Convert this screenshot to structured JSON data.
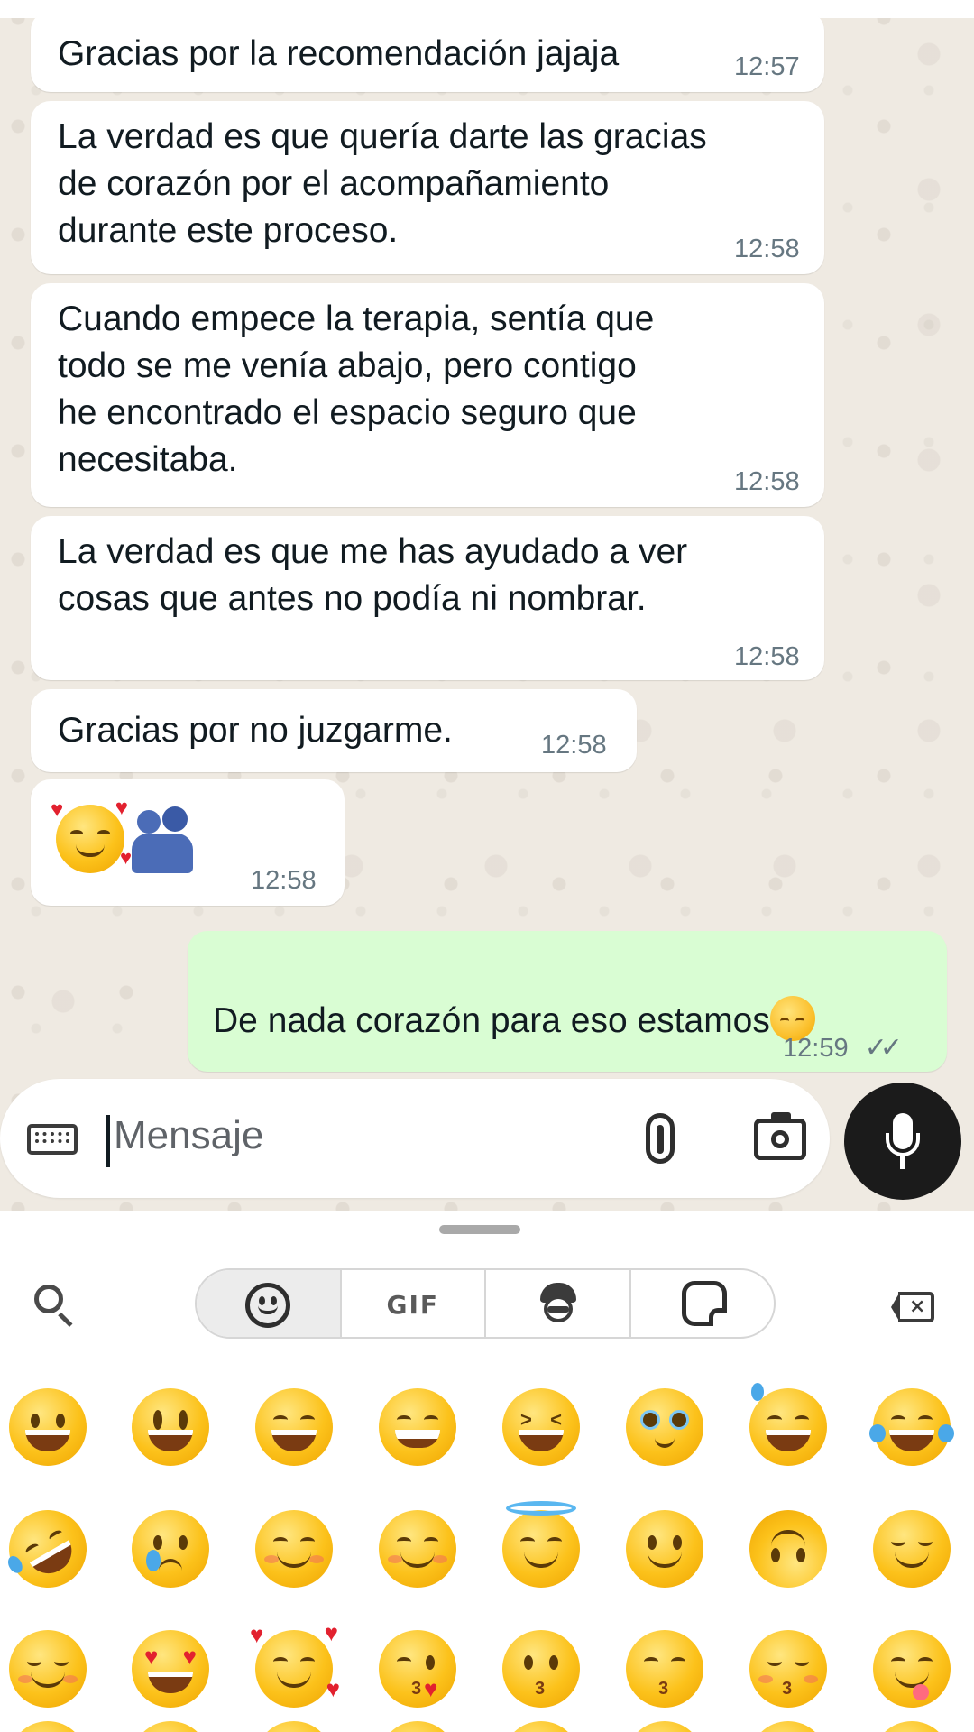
{
  "messages": [
    {
      "direction": "in",
      "text": "Gracias por la recomendación jajaja",
      "time": "12:57"
    },
    {
      "direction": "in",
      "text": "La verdad es que quería darte las gracias\nde corazón por el acompañamiento\ndurante este proceso.",
      "time": "12:58"
    },
    {
      "direction": "in",
      "text": "Cuando empece la terapia, sentía que\ntodo se me venía abajo, pero contigo\nhe encontrado el espacio seguro que\nnecesitaba.",
      "time": "12:58"
    },
    {
      "direction": "in",
      "text": "La verdad es que me has ayudado a ver\ncosas que antes no podía ni nombrar.",
      "time": "12:58"
    },
    {
      "direction": "in",
      "text": "Gracias por no juzgarme.",
      "time": "12:58"
    },
    {
      "direction": "in",
      "emojis": [
        "smiling-face-with-hearts",
        "people-hugging"
      ],
      "time": "12:58"
    },
    {
      "direction": "out",
      "text": "De nada corazón para eso estamos",
      "trailing_emoji": "smiling-face-with-smiling-eyes",
      "time": "12:59",
      "status": "read"
    }
  ],
  "composer": {
    "placeholder": "Mensaje",
    "keyboard_icon": "keyboard-icon",
    "attach_icon": "paperclip-icon",
    "camera_icon": "camera-icon",
    "mic_icon": "microphone-icon"
  },
  "emoji_keyboard": {
    "search_icon": "search-icon",
    "tabs": [
      {
        "icon": "emoji-tab-icon",
        "active": true
      },
      {
        "label": "GIF"
      },
      {
        "icon": "avatar-tab-icon"
      },
      {
        "icon": "sticker-tab-icon"
      }
    ],
    "backspace_icon": "backspace-icon",
    "grid": [
      [
        "grinning-face",
        "grinning-face-with-big-eyes",
        "grinning-face-with-smiling-eyes",
        "beaming-face",
        "grinning-squinting-face",
        "face-holding-back-tears",
        "grinning-face-with-sweat",
        "face-with-tears-of-joy"
      ],
      [
        "rolling-on-the-floor-laughing",
        "crying-face",
        "smiling-face",
        "smiling-face-with-smiling-eyes",
        "smiling-face-with-halo",
        "slightly-smiling-face",
        "upside-down-face",
        "relieved-face"
      ],
      [
        "smiling-face-closed-eyes",
        "smiling-face-with-heart-eyes",
        "smiling-face-with-hearts",
        "face-blowing-a-kiss",
        "kissing-face",
        "kissing-face-with-smiling-eyes",
        "kissing-face-with-closed-eyes",
        "face-savoring-food"
      ]
    ]
  },
  "colors": {
    "chat_background": "#efeae2",
    "incoming_bubble": "#ffffff",
    "outgoing_bubble": "#d9fdd3",
    "timestamp": "#667781",
    "mic_button": "#1b1b1b"
  }
}
